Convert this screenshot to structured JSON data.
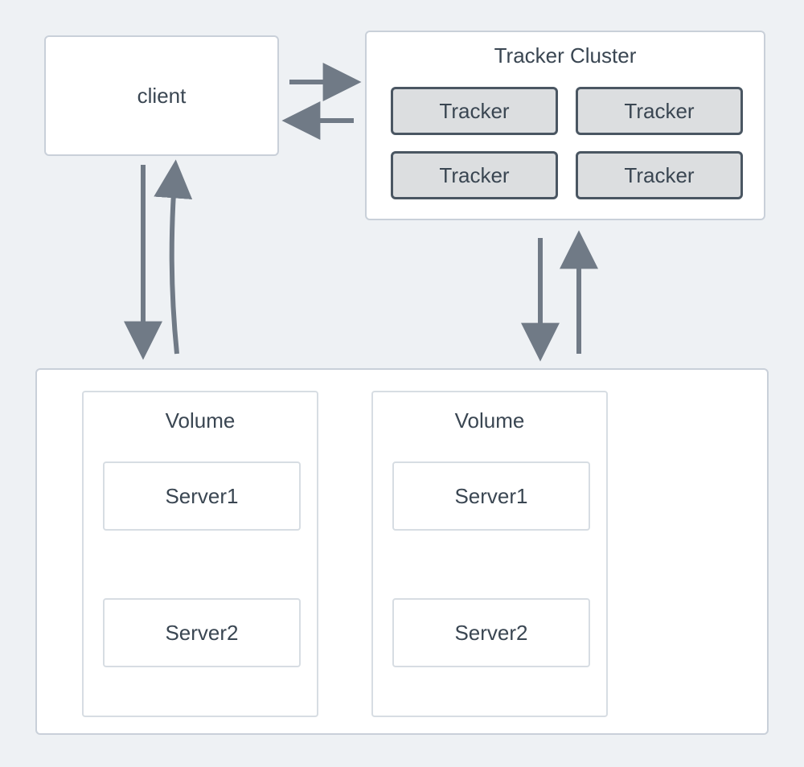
{
  "client": {
    "label": "client"
  },
  "tracker_cluster": {
    "title": "Tracker Cluster",
    "nodes": [
      "Tracker",
      "Tracker",
      "Tracker",
      "Tracker"
    ]
  },
  "storage": {
    "volumes": [
      {
        "title": "Volume",
        "servers": [
          "Server1",
          "Server2"
        ]
      },
      {
        "title": "Volume",
        "servers": [
          "Server1",
          "Server2"
        ]
      }
    ]
  },
  "arrows": [
    {
      "from": "client",
      "to": "tracker_cluster",
      "bidirectional": true
    },
    {
      "from": "client",
      "to": "storage",
      "bidirectional": true
    },
    {
      "from": "tracker_cluster",
      "to": "storage",
      "bidirectional": true
    }
  ],
  "colors": {
    "background": "#eef1f4",
    "box_border": "#c9d0d9",
    "tracker_fill": "#dcdee0",
    "tracker_border": "#4a5662",
    "arrow": "#707a86",
    "text": "#3a4652"
  }
}
